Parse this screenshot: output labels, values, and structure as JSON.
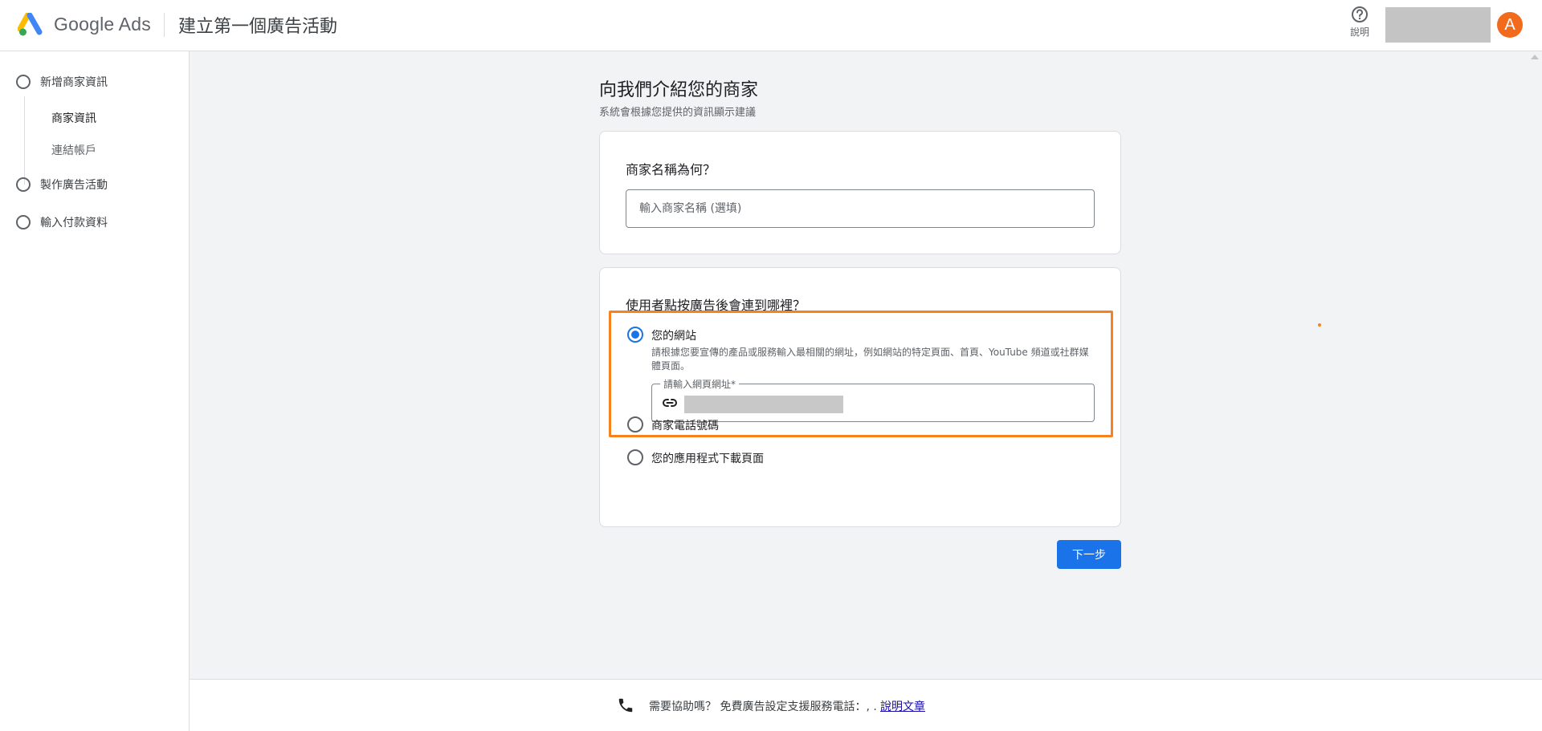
{
  "header": {
    "product_name": "Google Ads",
    "title": "建立第一個廣告活動",
    "help_icon": "help-circle-icon",
    "help_label": "說明",
    "avatar_letter": "A"
  },
  "sidebar": {
    "steps": [
      {
        "label": "新增商家資訊",
        "substeps": [
          "商家資訊",
          "連結帳戶"
        ],
        "active_substep": "商家資訊"
      },
      {
        "label": "製作廣告活動"
      },
      {
        "label": "輸入付款資料"
      }
    ]
  },
  "main": {
    "title": "向我們介紹您的商家",
    "subtitle": "系統會根據您提供的資訊顯示建議",
    "business_name": {
      "question": "商家名稱為何？",
      "placeholder": "輸入商家名稱 (選填)",
      "value": ""
    },
    "destination": {
      "question": "使用者點按廣告後會連到哪裡？",
      "options": [
        {
          "label": "您的網站",
          "selected": true,
          "description": "請根據您要宣傳的產品或服務輸入最相關的網址，例如網站的特定頁面、首頁、YouTube 頻道或社群媒體頁面。",
          "url_field_label": "請輸入網頁網址*",
          "url_icon": "link-icon"
        },
        {
          "label": "商家電話號碼",
          "selected": false
        },
        {
          "label": "您的應用程式下載頁面",
          "selected": false
        }
      ]
    },
    "next_button": "下一步"
  },
  "footer": {
    "icon": "phone-icon",
    "text": "需要協助嗎？ 免費廣告設定支援服務電話：, .",
    "link": "說明文章"
  },
  "colors": {
    "primary": "#1a73e8",
    "avatar": "#f26b1d",
    "highlight": "#f6821f"
  }
}
